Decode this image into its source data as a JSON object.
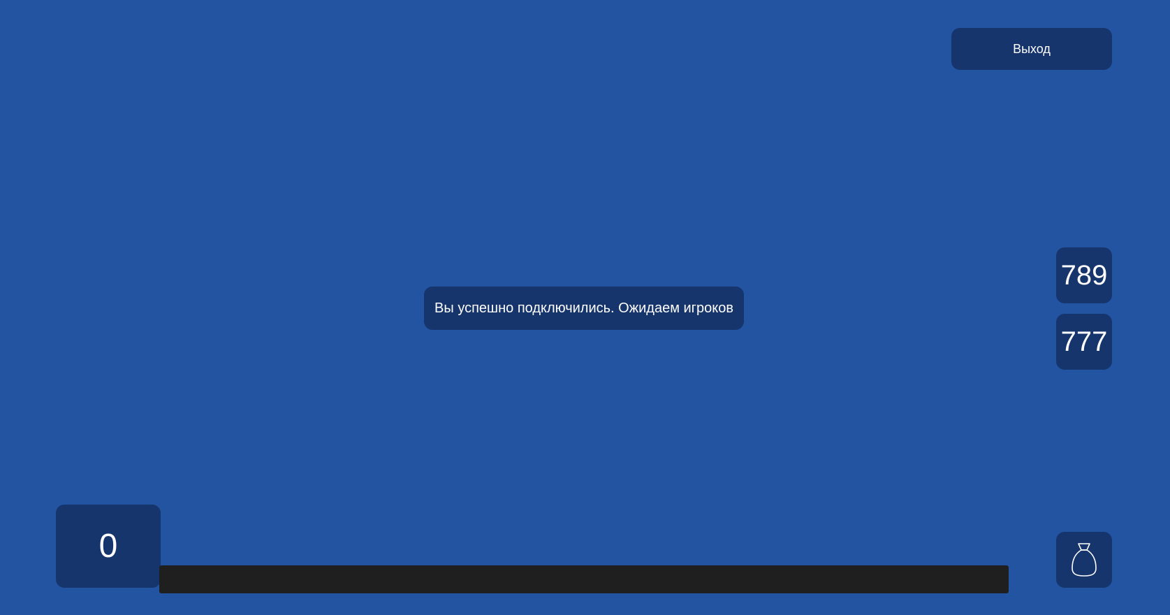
{
  "header": {
    "exit_label": "Выход"
  },
  "status": {
    "message": "Вы успешно подключились. Ожидаем игроков"
  },
  "side_counters": {
    "top_value": "789",
    "bottom_value": "777"
  },
  "player": {
    "score": "0"
  },
  "progress": {
    "fraction": 0
  },
  "icons": {
    "bag": "bag-icon"
  },
  "colors": {
    "background": "#2354a1",
    "panel": "#16356c",
    "progress_track": "#1f1f1f",
    "text": "#ffffff"
  }
}
